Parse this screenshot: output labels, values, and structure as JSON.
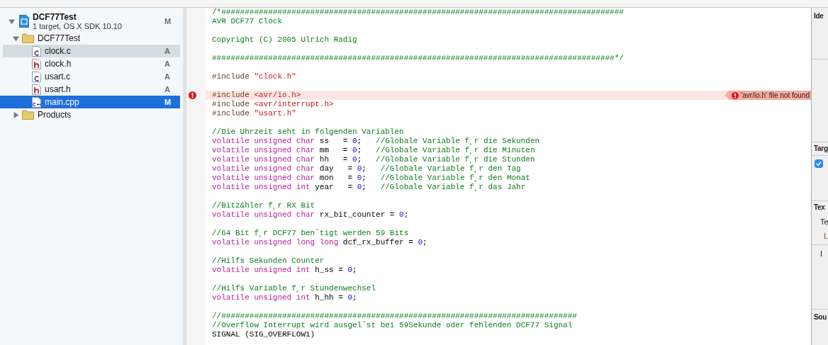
{
  "navigator": {
    "project": {
      "name": "DCF77Test",
      "subtitle": "1 target, OS X SDK 10.10",
      "badge": "M",
      "expanded": true,
      "selected": false,
      "children": [
        {
          "name": "DCF77Test",
          "kind": "folder",
          "expanded": true,
          "selected": false,
          "highlighted": false,
          "children": [
            {
              "name": "clock.c",
              "kind": "c",
              "badge": "A",
              "selected": false,
              "highlighted": true
            },
            {
              "name": "clock.h",
              "kind": "h",
              "badge": "A",
              "selected": false,
              "highlighted": false
            },
            {
              "name": "usart.c",
              "kind": "c",
              "badge": "A",
              "selected": false,
              "highlighted": false
            },
            {
              "name": "usart.h",
              "kind": "h",
              "badge": "A",
              "selected": false,
              "highlighted": false
            },
            {
              "name": "main.cpp",
              "kind": "cpp",
              "badge": "M",
              "selected": true,
              "highlighted": false
            }
          ]
        },
        {
          "name": "Products",
          "kind": "folder",
          "expanded": false,
          "selected": false,
          "highlighted": false
        }
      ]
    }
  },
  "editor": {
    "lines": [
      {
        "kind": "code",
        "tokens": [
          {
            "kind": "comment",
            "text": "/*######################################################################################"
          }
        ]
      },
      {
        "kind": "code",
        "tokens": [
          {
            "kind": "comment",
            "text": "AVR DCF77 Clock"
          }
        ]
      },
      {
        "kind": "blank"
      },
      {
        "kind": "code",
        "tokens": [
          {
            "kind": "comment",
            "text": "Copyright (C) 2005 Ulrich Radig"
          }
        ]
      },
      {
        "kind": "blank"
      },
      {
        "kind": "code",
        "tokens": [
          {
            "kind": "comment",
            "text": "######################################################################################*/"
          }
        ]
      },
      {
        "kind": "blank"
      },
      {
        "kind": "code",
        "tokens": [
          {
            "kind": "preprocessor",
            "text": "#include "
          },
          {
            "kind": "string",
            "text": "\"clock.h\""
          }
        ]
      },
      {
        "kind": "blank"
      },
      {
        "kind": "code",
        "tokens": [
          {
            "kind": "preprocessor",
            "text": "#include "
          },
          {
            "kind": "string",
            "text": "<avr/io.h>"
          }
        ],
        "issue": "'avr/io.h' file not found"
      },
      {
        "kind": "code",
        "tokens": [
          {
            "kind": "preprocessor",
            "text": "#include "
          },
          {
            "kind": "string",
            "text": "<avr/interrupt.h>"
          }
        ]
      },
      {
        "kind": "code",
        "tokens": [
          {
            "kind": "preprocessor",
            "text": "#include "
          },
          {
            "kind": "string",
            "text": "\"usart.h\""
          }
        ]
      },
      {
        "kind": "blank"
      },
      {
        "kind": "code",
        "tokens": [
          {
            "kind": "comment",
            "text": "//Die Uhrzeit seht in folgenden Variablen"
          }
        ]
      },
      {
        "kind": "code",
        "tokens": [
          {
            "kind": "keyword",
            "text": "volatile unsigned char"
          },
          {
            "kind": "plain",
            "text": " ss   = "
          },
          {
            "kind": "number",
            "text": "0"
          },
          {
            "kind": "plain",
            "text": ";   "
          },
          {
            "kind": "comment",
            "text": "//Globale Variable f¸r die Sekunden"
          }
        ]
      },
      {
        "kind": "code",
        "tokens": [
          {
            "kind": "keyword",
            "text": "volatile unsigned char"
          },
          {
            "kind": "plain",
            "text": " mm   = "
          },
          {
            "kind": "number",
            "text": "0"
          },
          {
            "kind": "plain",
            "text": ";   "
          },
          {
            "kind": "comment",
            "text": "//Globale Variable f¸r die Minuten"
          }
        ]
      },
      {
        "kind": "code",
        "tokens": [
          {
            "kind": "keyword",
            "text": "volatile unsigned char"
          },
          {
            "kind": "plain",
            "text": " hh   = "
          },
          {
            "kind": "number",
            "text": "0"
          },
          {
            "kind": "plain",
            "text": ";   "
          },
          {
            "kind": "comment",
            "text": "//Globale Variable f¸r die Stunden"
          }
        ]
      },
      {
        "kind": "code",
        "tokens": [
          {
            "kind": "keyword",
            "text": "volatile unsigned char"
          },
          {
            "kind": "plain",
            "text": " day   = "
          },
          {
            "kind": "number",
            "text": "0"
          },
          {
            "kind": "plain",
            "text": ";   "
          },
          {
            "kind": "comment",
            "text": "//Globale Variable f¸r den Tag"
          }
        ]
      },
      {
        "kind": "code",
        "tokens": [
          {
            "kind": "keyword",
            "text": "volatile unsigned char"
          },
          {
            "kind": "plain",
            "text": " mon   = "
          },
          {
            "kind": "number",
            "text": "0"
          },
          {
            "kind": "plain",
            "text": ";   "
          },
          {
            "kind": "comment",
            "text": "//Globale Variable f¸r den Monat"
          }
        ]
      },
      {
        "kind": "code",
        "tokens": [
          {
            "kind": "keyword",
            "text": "volatile unsigned int"
          },
          {
            "kind": "plain",
            "text": " year   = "
          },
          {
            "kind": "number",
            "text": "0"
          },
          {
            "kind": "plain",
            "text": ";   "
          },
          {
            "kind": "comment",
            "text": "//Globale Variable f¸r das Jahr"
          }
        ]
      },
      {
        "kind": "blank"
      },
      {
        "kind": "code",
        "tokens": [
          {
            "kind": "comment",
            "text": "//Bitz&hler f¸r RX Bit"
          }
        ]
      },
      {
        "kind": "code",
        "tokens": [
          {
            "kind": "keyword",
            "text": "volatile unsigned char"
          },
          {
            "kind": "plain",
            "text": " rx_bit_counter = "
          },
          {
            "kind": "number",
            "text": "0"
          },
          {
            "kind": "plain",
            "text": ";"
          }
        ]
      },
      {
        "kind": "blank"
      },
      {
        "kind": "code",
        "tokens": [
          {
            "kind": "comment",
            "text": "//64 Bit f¸r DCF77 benˆtigt werden 59 Bits"
          }
        ]
      },
      {
        "kind": "code",
        "tokens": [
          {
            "kind": "keyword",
            "text": "volatile unsigned long long"
          },
          {
            "kind": "plain",
            "text": " dcf_rx_buffer = "
          },
          {
            "kind": "number",
            "text": "0"
          },
          {
            "kind": "plain",
            "text": ";"
          }
        ]
      },
      {
        "kind": "blank"
      },
      {
        "kind": "code",
        "tokens": [
          {
            "kind": "comment",
            "text": "//Hilfs Sekunden Counter"
          }
        ]
      },
      {
        "kind": "code",
        "tokens": [
          {
            "kind": "keyword",
            "text": "volatile unsigned int"
          },
          {
            "kind": "plain",
            "text": " h_ss = "
          },
          {
            "kind": "number",
            "text": "0"
          },
          {
            "kind": "plain",
            "text": ";"
          }
        ]
      },
      {
        "kind": "blank"
      },
      {
        "kind": "code",
        "tokens": [
          {
            "kind": "comment",
            "text": "//Hilfs Variable f¸r Stundenwechsel"
          }
        ]
      },
      {
        "kind": "code",
        "tokens": [
          {
            "kind": "keyword",
            "text": "volatile unsigned int"
          },
          {
            "kind": "plain",
            "text": " h_hh = "
          },
          {
            "kind": "number",
            "text": "0"
          },
          {
            "kind": "plain",
            "text": ";"
          }
        ]
      },
      {
        "kind": "blank"
      },
      {
        "kind": "code",
        "tokens": [
          {
            "kind": "comment",
            "text": "//############################################################################"
          }
        ]
      },
      {
        "kind": "code",
        "tokens": [
          {
            "kind": "comment",
            "text": "//Overflow Interrupt wird ausgelˆst bei 59Sekunde oder fehlenden DCF77 Signal"
          }
        ]
      },
      {
        "kind": "code",
        "tokens": [
          {
            "kind": "plain",
            "text": "SIGNAL (SIG_OVERFLOW1)"
          }
        ]
      }
    ]
  },
  "inspector": {
    "identity_label": "Ide",
    "target_label": "Targ",
    "target_checked": true,
    "text_label": "Tex",
    "text_rows": [
      {
        "kind": "label",
        "text": "Te"
      },
      {
        "kind": "link",
        "text": "L"
      },
      {
        "kind": "label",
        "text": "I"
      }
    ],
    "source_label": "Sou"
  }
}
